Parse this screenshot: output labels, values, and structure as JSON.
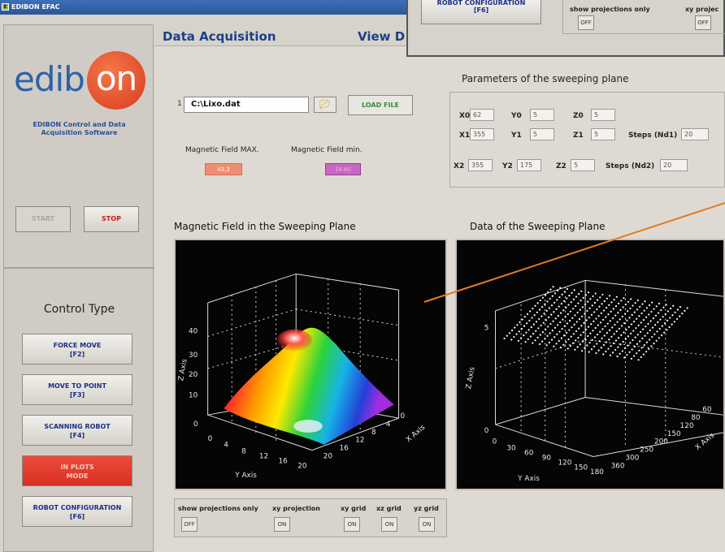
{
  "window": {
    "title": "EDIBON EFAC"
  },
  "tabs": [
    {
      "label": "Data Acquisition"
    },
    {
      "label": "View D"
    }
  ],
  "left": {
    "logo": "edibon",
    "software_title": "EDIBON Control and Data Acquisition Software",
    "start_label": "START",
    "stop_label": "STOP",
    "control_type_title": "Control Type",
    "buttons": [
      {
        "line1": "FORCE MOVE",
        "line2": "[F2]"
      },
      {
        "line1": "MOVE TO POINT",
        "line2": "[F3]"
      },
      {
        "line1": "SCANNING ROBOT",
        "line2": "[F4]"
      },
      {
        "line1": "IN PLOTS",
        "line2": "MODE"
      },
      {
        "line1": "ROBOT CONFIGURATION",
        "line2": "[F6]"
      }
    ]
  },
  "file": {
    "path": "C:\\Lixo.dat",
    "path_prefix": "1",
    "load_label": "LOAD FILE",
    "field_max_label": "Magnetic Field MAX.",
    "field_min_label": "Magnetic Field min.",
    "field_max_value": "43,3",
    "field_min_value": "18.60"
  },
  "params": {
    "title": "Parameters of the sweeping plane",
    "row1": {
      "x_label": "X0",
      "x": "62",
      "y_label": "Y0",
      "y": "5",
      "z_label": "Z0",
      "z": "5"
    },
    "row2": {
      "x_label": "X1",
      "x": "355",
      "y_label": "Y1",
      "y": "5",
      "z_label": "Z1",
      "z": "5",
      "steps_label": "Steps (Nd1)",
      "steps": "20"
    },
    "row3": {
      "x_label": "X2",
      "x": "355",
      "y_label": "Y2",
      "y": "175",
      "z_label": "Z2",
      "z": "5",
      "steps_label": "Steps (Nd2)",
      "steps": "20"
    }
  },
  "plots": {
    "left_title": "Magnetic Field in the Sweeping Plane",
    "right_title": "Data of the Sweeping Plane",
    "left_axes": {
      "x_label": "X Axis",
      "y_label": "Y Axis",
      "z_label": "Z Axis",
      "z_ticks": [
        "0",
        "10",
        "20",
        "30",
        "40"
      ],
      "y_ticks": [
        "0",
        "4",
        "8",
        "12",
        "16",
        "20"
      ],
      "x_ticks": [
        "20",
        "16",
        "12",
        "8",
        "4",
        "0"
      ]
    },
    "right_axes": {
      "x_label": "X Axis",
      "y_label": "Y Axis",
      "z_label": "Z Axis",
      "z_ticks": [
        "0",
        "5"
      ],
      "y_ticks": [
        "0",
        "30",
        "60",
        "90",
        "120",
        "150",
        "180"
      ],
      "x_ticks": [
        "360",
        "300",
        "250",
        "200",
        "150",
        "120",
        "80",
        "60"
      ]
    }
  },
  "projections": {
    "show_only_label": "show projections only",
    "xy_projection_label": "xy projection",
    "xy_grid_label": "xy grid",
    "xz_grid_label": "xz grid",
    "yz_grid_label": "yz grid",
    "show_only_value": "OFF",
    "xy_projection_value": "ON",
    "xy_grid_value": "ON",
    "xz_grid_value": "ON",
    "yz_grid_value": "ON"
  },
  "overlay": {
    "robot_config_line1": "ROBOT CONFIGURATION",
    "robot_config_line2": "[F6]",
    "show_only_label": "show projections only",
    "xy_projection_label": "xy projec",
    "show_only_value": "OFF",
    "xy_projection_value": "OFF"
  },
  "colors": {
    "pointer_line": "#e77a1e",
    "accent_blue": "#1f3f86",
    "stop_red": "#c91d18"
  }
}
